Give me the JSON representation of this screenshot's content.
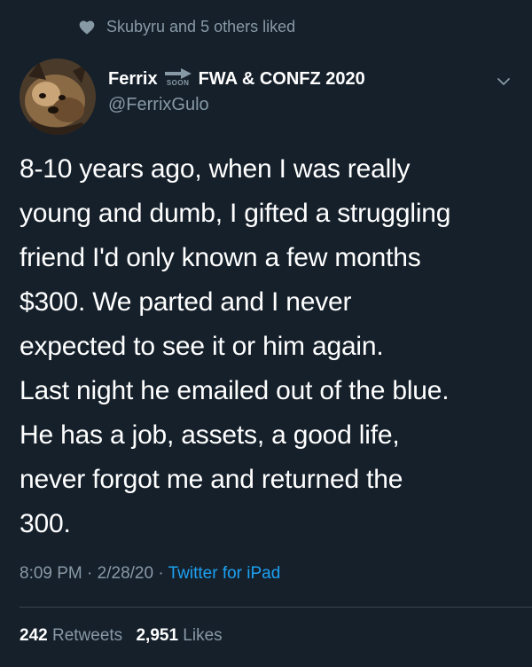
{
  "social_context": {
    "text": "Skubyru and 5 others liked"
  },
  "author": {
    "name": "Ferrix",
    "soon_label": "SOON",
    "name_suffix": "FWA & CONFZ 2020",
    "handle": "@FerrixGulo"
  },
  "tweet": {
    "lines": [
      "8-10 years ago, when I was really",
      "young and dumb, I gifted a struggling",
      "friend I'd only known a few months",
      "$300. We parted and I never",
      "expected to see it or him again.",
      "Last night he emailed out of the blue.",
      "He has a job, assets, a good life,",
      "never forgot me and returned the",
      "300."
    ]
  },
  "meta": {
    "time": "8:09 PM",
    "separator": "·",
    "date": "2/28/20",
    "source": "Twitter for iPad"
  },
  "stats": {
    "retweets_count": "242",
    "retweets_label": "Retweets",
    "likes_count": "2,951",
    "likes_label": "Likes"
  },
  "colors": {
    "background": "#15202b",
    "secondary_text": "#8899a6",
    "link": "#1da1f2",
    "divider": "#38444d"
  }
}
